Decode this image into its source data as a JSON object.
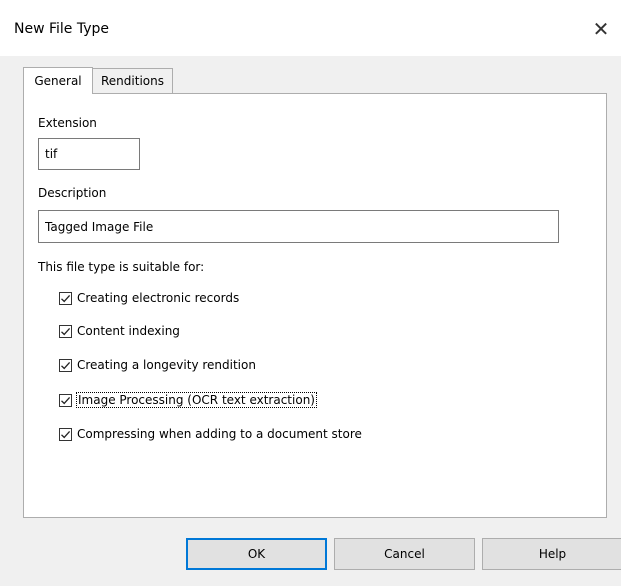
{
  "window": {
    "title": "New File Type",
    "close_glyph": "✕"
  },
  "tabs": [
    {
      "label": "General",
      "active": true
    },
    {
      "label": "Renditions",
      "active": false
    }
  ],
  "general": {
    "extension_label": "Extension",
    "extension_value": "tif",
    "description_label": "Description",
    "description_value": "Tagged Image File",
    "suitable_label": "This file type is suitable for:",
    "options": [
      {
        "label": "Creating electronic records",
        "checked": true
      },
      {
        "label": "Content indexing",
        "checked": true
      },
      {
        "label": "Creating a longevity rendition",
        "checked": true
      },
      {
        "label": "Image Processing (OCR text extraction)",
        "checked": true,
        "focused": true
      },
      {
        "label": "Compressing when adding to a document store",
        "checked": true
      }
    ]
  },
  "buttons": {
    "ok": "OK",
    "cancel": "Cancel",
    "help": "Help"
  },
  "colors": {
    "accent": "#0078d7",
    "window_bg": "#f0f0f0",
    "panel_bg": "#ffffff"
  },
  "icons": {
    "close": "close-icon",
    "checkmark": "checkmark-icon"
  }
}
